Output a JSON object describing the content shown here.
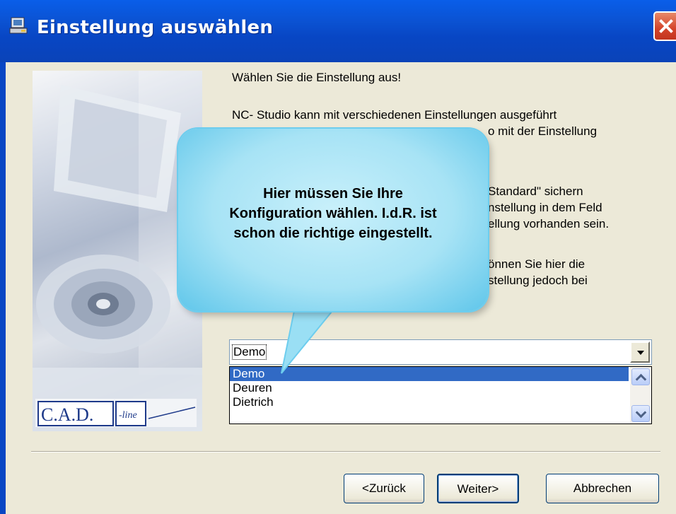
{
  "window": {
    "title": "Einstellung auswählen"
  },
  "instructions": {
    "line1": "Wählen Sie die Einstellung aus!",
    "para2_l1": "NC- Studio kann mit verschiedenen Einstellungen ausgeführt",
    "para2_l2": "o mit der Einstellung",
    "para3_l1": "Standard\" sichern",
    "para3_l2": "nstellung in dem Feld",
    "para3_l3": "ellung vorhanden sein.",
    "para4_l1": "önnen Sie hier die",
    "para4_l2": "stellung jedoch bei"
  },
  "callout": {
    "text_line1": "Hier müssen Sie Ihre",
    "text_line2": "Konfiguration wählen. I.d.R. ist",
    "text_line3": "schon die richtige eingestellt."
  },
  "config_select": {
    "value": "Demo",
    "options": [
      "Demo",
      "Deuren",
      "Dietrich"
    ],
    "selected_index": 0
  },
  "logo": {
    "text": "C.A.D.",
    "script": "-line"
  },
  "buttons": {
    "back": "<Zurück",
    "next": "Weiter>",
    "cancel": "Abbrechen"
  },
  "colors": {
    "titlebar": "#0a52d2",
    "selection": "#316ac5",
    "callout": "#a7e3f5",
    "dialog_bg": "#ece9d8"
  }
}
